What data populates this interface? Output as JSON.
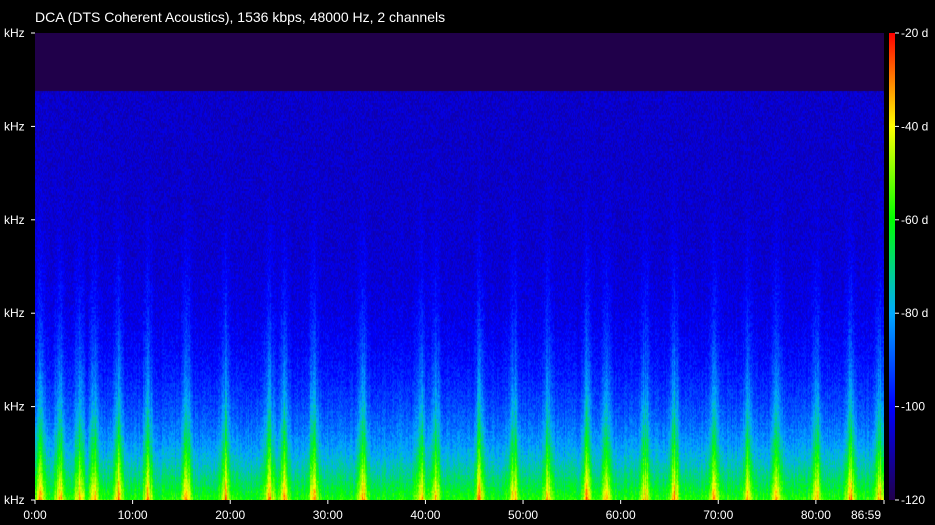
{
  "title": "DCA (DTS Coherent Acoustics), 1536 kbps, 48000 Hz, 2 channels",
  "chart_data": {
    "type": "heatmap",
    "title": "DCA (DTS Coherent Acoustics), 1536 kbps, 48000 Hz, 2 channels",
    "y_tick_labels": [
      "kHz",
      "kHz",
      "kHz",
      "kHz",
      "kHz",
      "kHz"
    ],
    "x_tick_labels": [
      "0:00",
      "10:00",
      "20:00",
      "30:00",
      "40:00",
      "50:00",
      "60:00",
      "70:00",
      "80:00",
      "86:59"
    ],
    "x_ticks_minutes": [
      0,
      10,
      20,
      30,
      40,
      50,
      60,
      70,
      80,
      86.98
    ],
    "x_range_minutes": [
      0,
      86.98
    ],
    "colorbar": {
      "tick_labels": [
        "-20 d",
        "-40 d",
        "-60 d",
        "-80 d",
        "-100",
        "-120"
      ],
      "tick_values_db": [
        -20,
        -40,
        -60,
        -80,
        -100,
        -120
      ],
      "range_db": [
        -120,
        -20
      ],
      "colors": [
        "#ff0000",
        "#ffff00",
        "#00ff00",
        "#00aaff",
        "#0000ff",
        "#20004a"
      ]
    },
    "spectrogram": {
      "cutoff_fraction": 0.875,
      "above_cutoff_db": -120,
      "background_db": -106,
      "low_freq_db": -62,
      "loud_columns_minutes": [
        0.5,
        2.5,
        4.5,
        6.0,
        8.5,
        11.5,
        15.5,
        19.5,
        24.0,
        25.5,
        28.5,
        33.5,
        39.5,
        41.0,
        45.5,
        49.0,
        52.5,
        56.5,
        58.5,
        62.5,
        65.5,
        69.5,
        73.0,
        76.0,
        80.0,
        83.5,
        86.5
      ]
    }
  }
}
